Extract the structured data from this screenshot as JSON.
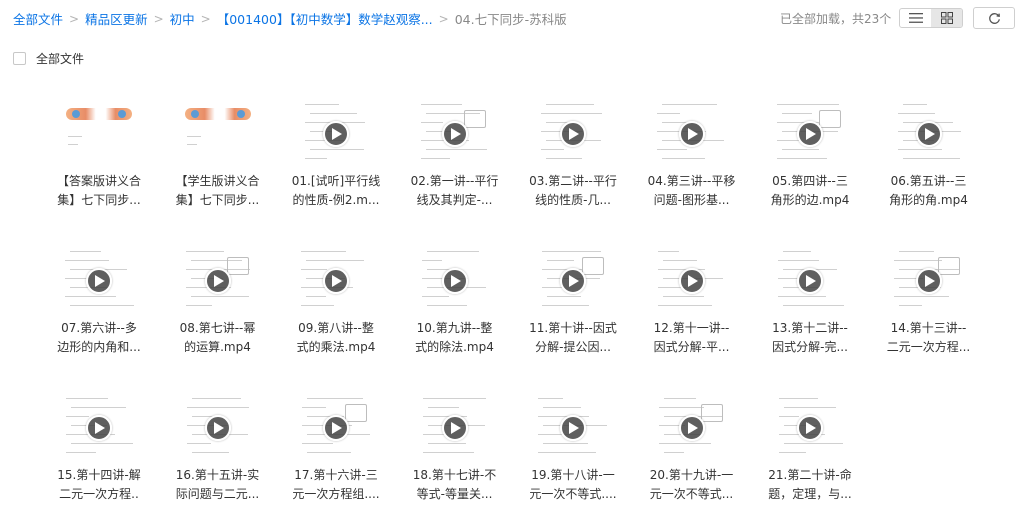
{
  "breadcrumb": [
    {
      "label": "全部文件",
      "current": false
    },
    {
      "label": "精品区更新",
      "current": false
    },
    {
      "label": "初中",
      "current": false
    },
    {
      "label": "【001400】【初中数学】数学赵观察...",
      "current": false
    },
    {
      "label": "04.七下同步-苏科版",
      "current": true
    }
  ],
  "status": "已全部加载，共23个",
  "view": {
    "list_icon": "list-view-icon",
    "grid_icon": "grid-view-icon",
    "active": "grid",
    "refresh_icon": "refresh-icon"
  },
  "select_all_label": "全部文件",
  "files": [
    {
      "line1": "【答案版讲义合",
      "line2": "集】七下同步...",
      "type": "doc"
    },
    {
      "line1": "【学生版讲义合",
      "line2": "集】七下同步...",
      "type": "doc"
    },
    {
      "line1": "01.[试听]平行线",
      "line2": "的性质-例2.m...",
      "type": "video"
    },
    {
      "line1": "02.第一讲--平行",
      "line2": "线及其判定-...",
      "type": "video"
    },
    {
      "line1": "03.第二讲--平行",
      "line2": "线的性质-几...",
      "type": "video"
    },
    {
      "line1": "04.第三讲--平移",
      "line2": "问题-图形基...",
      "type": "video"
    },
    {
      "line1": "05.第四讲--三",
      "line2": "角形的边.mp4",
      "type": "video"
    },
    {
      "line1": "06.第五讲--三",
      "line2": "角形的角.mp4",
      "type": "video"
    },
    {
      "line1": "07.第六讲--多",
      "line2": "边形的内角和...",
      "type": "video"
    },
    {
      "line1": "08.第七讲--幂",
      "line2": "的运算.mp4",
      "type": "video"
    },
    {
      "line1": "09.第八讲--整",
      "line2": "式的乘法.mp4",
      "type": "video"
    },
    {
      "line1": "10.第九讲--整",
      "line2": "式的除法.mp4",
      "type": "video"
    },
    {
      "line1": "11.第十讲--因式",
      "line2": "分解-提公因...",
      "type": "video"
    },
    {
      "line1": "12.第十一讲--",
      "line2": "因式分解-平...",
      "type": "video"
    },
    {
      "line1": "13.第十二讲--",
      "line2": "因式分解-完...",
      "type": "video"
    },
    {
      "line1": "14.第十三讲--",
      "line2": "二元一次方程...",
      "type": "video"
    },
    {
      "line1": "15.第十四讲-解",
      "line2": "二元一次方程..",
      "type": "video"
    },
    {
      "line1": "16.第十五讲-实",
      "line2": "际问题与二元...",
      "type": "video"
    },
    {
      "line1": "17.第十六讲-三",
      "line2": "元一次方程组....",
      "type": "video"
    },
    {
      "line1": "18.第十七讲-不",
      "line2": "等式-等量关...",
      "type": "video"
    },
    {
      "line1": "19.第十八讲-一",
      "line2": "元一次不等式....",
      "type": "video"
    },
    {
      "line1": "20.第十九讲-一",
      "line2": "元一次不等式...",
      "type": "video"
    },
    {
      "line1": "21.第二十讲-命",
      "line2": "题，定理，与...",
      "type": "video"
    }
  ]
}
